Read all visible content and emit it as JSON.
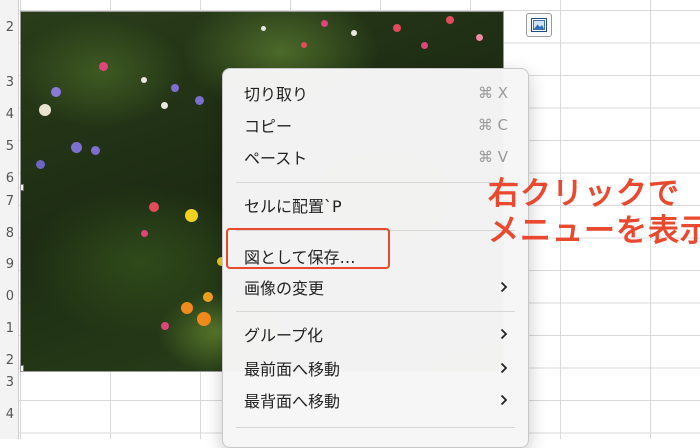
{
  "row_numbers": [
    "2",
    "3",
    "4",
    "5",
    "6",
    "7",
    "8",
    "9",
    "0",
    "1",
    "2",
    "3",
    "4"
  ],
  "image_icon": "picture-icon",
  "context_menu": {
    "items": [
      {
        "label": "切り取り",
        "shortcut": "⌘ X"
      },
      {
        "label": "コピー",
        "shortcut": "⌘ C"
      },
      {
        "label": "ペースト",
        "shortcut": "⌘ V"
      },
      {
        "label": "セルに配置`P",
        "shortcut": ""
      },
      {
        "label": "図として保存…",
        "shortcut": ""
      },
      {
        "label": "画像の変更",
        "submenu": true
      },
      {
        "label": "グループ化",
        "submenu": true
      },
      {
        "label": "最前面へ移動",
        "submenu": true
      },
      {
        "label": "最背面へ移動",
        "submenu": true
      }
    ]
  },
  "annotation": {
    "line1": "右クリックで",
    "line2": "メニューを表示",
    "color": "#e8492f"
  }
}
